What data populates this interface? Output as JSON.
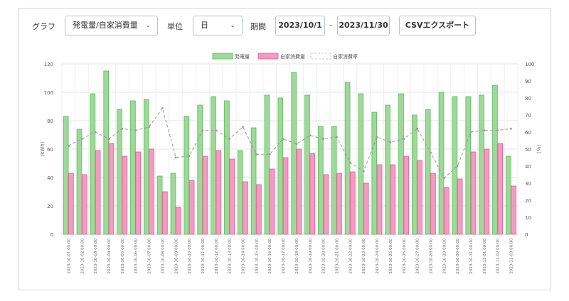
{
  "toolbar": {
    "graph_label": "グラフ",
    "graph_select": "発電量/自家消費量",
    "unit_label": "単位",
    "unit_select": "日",
    "period_label": "期間",
    "start_date": "2023/10/1",
    "period_separator": "-",
    "end_date": "2023/11/30",
    "export_button": "CSVエクスポート"
  },
  "chart_data": {
    "type": "bar",
    "legend": [
      "発電量",
      "自家消費量",
      "自家消費率"
    ],
    "ylabel_left": "(kWh)",
    "ylabel_right": "(%)",
    "ylim_left": [
      0,
      120
    ],
    "ylim_right": [
      0,
      100
    ],
    "yticks_left": [
      "0",
      "20",
      "40",
      "60",
      "80",
      "100",
      "120"
    ],
    "yticks_right": [
      "0",
      "10",
      "20",
      "30",
      "40",
      "50",
      "60",
      "70",
      "80",
      "90",
      "100"
    ],
    "legend_position": "top-center",
    "grid": true,
    "colors": {
      "generation_fill": "#9fd99a",
      "generation_stroke": "#5cb85c",
      "consumption_fill": "#f59ac0",
      "consumption_stroke": "#e0609a",
      "rate_line": "#9a9a9a"
    },
    "categories": [
      "2023-10-01 00:00",
      "2023-10-02 00:00",
      "2023-10-03 00:00",
      "2023-10-04 00:00",
      "2023-10-05 00:00",
      "2023-10-06 00:00",
      "2023-10-07 00:00",
      "2023-10-08 00:00",
      "2023-10-09 00:00",
      "2023-10-10 00:00",
      "2023-10-11 00:00",
      "2023-10-12 00:00",
      "2023-10-13 00:00",
      "2023-10-14 00:00",
      "2023-10-15 00:00",
      "2023-10-16 00:00",
      "2023-10-17 00:00",
      "2023-10-18 00:00",
      "2023-10-19 00:00",
      "2023-10-20 00:00",
      "2023-10-21 00:00",
      "2023-10-22 00:00",
      "2023-10-23 00:00",
      "2023-10-24 00:00",
      "2023-10-25 00:00",
      "2023-10-26 00:00",
      "2023-10-27 00:00",
      "2023-10-28 00:00",
      "2023-10-29 00:00",
      "2023-10-30 00:00",
      "2023-10-31 00:00",
      "2023-11-01 00:00",
      "2023-11-02 00:00"
    ],
    "series": [
      {
        "name": "発電量",
        "values": [
          83,
          74,
          99,
          115,
          88,
          94,
          95,
          41,
          43,
          83,
          91,
          97,
          94,
          59,
          75,
          98,
          96,
          114,
          98,
          76,
          76,
          107,
          99,
          86,
          91,
          99,
          84,
          88,
          100,
          97,
          97,
          98,
          105
        ]
      },
      {
        "name": "自家消費量",
        "values": [
          43,
          42,
          59,
          64,
          55,
          58,
          60,
          30,
          19,
          38,
          55,
          59,
          53,
          37,
          35,
          46,
          54,
          60,
          57,
          42,
          43,
          44,
          36,
          49,
          49,
          55,
          52,
          43,
          33,
          39,
          58,
          60,
          64
        ]
      },
      {
        "name": "自家消費率",
        "values": [
          52,
          56,
          60,
          56,
          62,
          61,
          63,
          74,
          45,
          46,
          61,
          61,
          56,
          63,
          47,
          47,
          56,
          53,
          58,
          56,
          57,
          42,
          37,
          57,
          54,
          56,
          62,
          48,
          33,
          40,
          60,
          61,
          61
        ]
      }
    ],
    "extra_category": "2023-11-03 00:00",
    "extra_generation": 55,
    "extra_consumption": 34,
    "extra_rate": 62
  }
}
